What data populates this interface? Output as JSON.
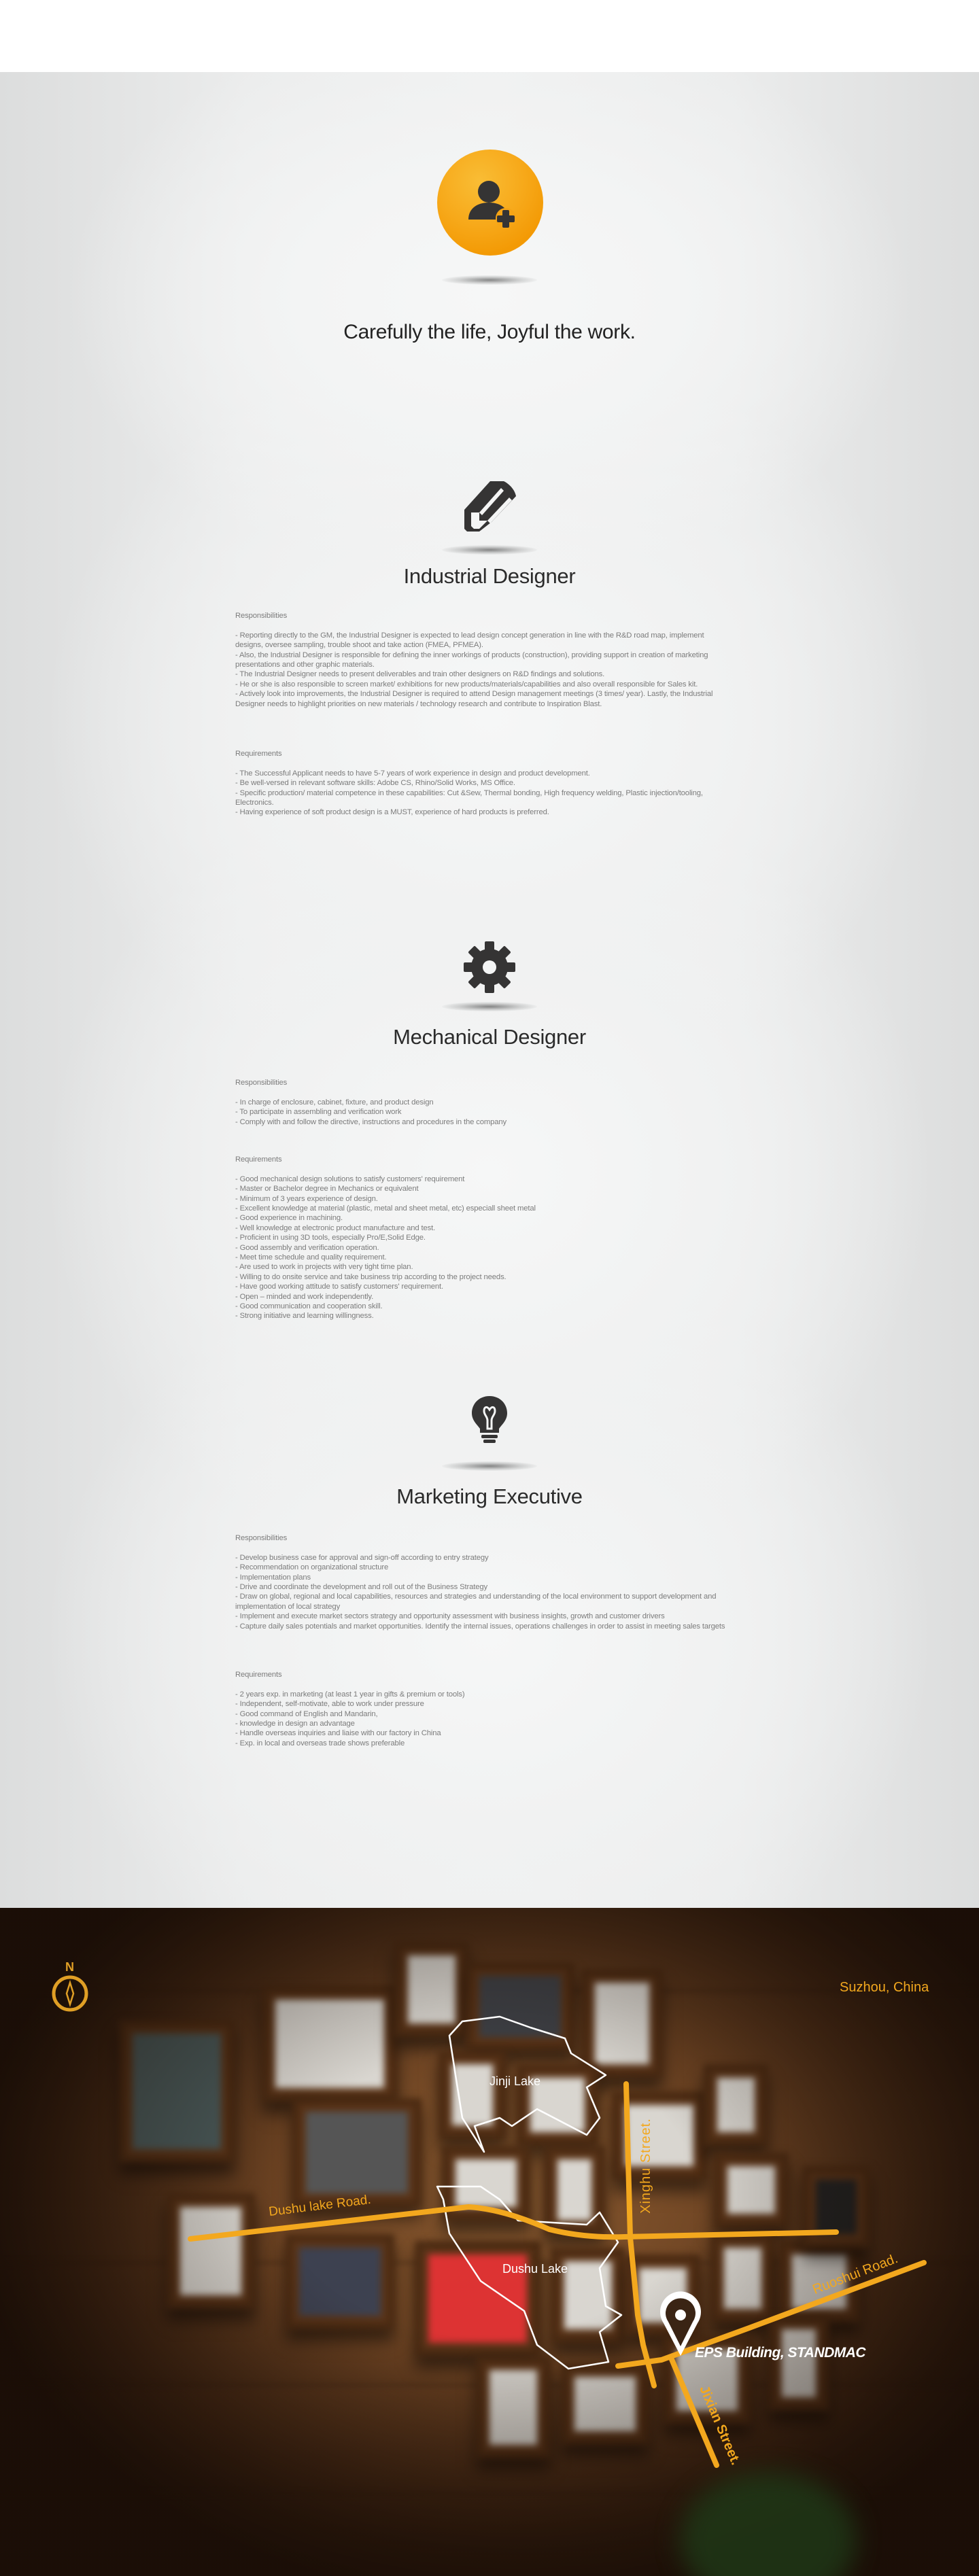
{
  "brand_color": "#f39c12",
  "hero": {
    "icon": "add-user-icon",
    "tagline": "Carefully the life, Joyful the work."
  },
  "positions": [
    {
      "icon": "pencil-icon",
      "title": "Industrial Designer",
      "responsibilities_label": "Responsibilities",
      "responsibilities": [
        "- Reporting directly to the GM, the Industrial Designer is expected to lead design concept generation in line with the R&D road map, implement designs, oversee sampling, trouble shoot and take action (FMEA, PFMEA).",
        "- Also, the Industrial Designer is responsible for defining the inner workings of products (construction), providing support in creation of marketing presentations and other graphic materials.",
        "- The Industrial Designer needs to present deliverables and train other designers on R&D findings and solutions.",
        "- He or she is also responsible to screen market/ exhibitions for new products/materials/capabilities and also overall responsible for Sales kit.",
        "- Actively look into improvements, the Industrial Designer is required to attend Design management meetings (3 times/ year). Lastly, the Industrial Designer needs to highlight priorities on new materials / technology research and contribute to Inspiration Blast."
      ],
      "requirements_label": "Requirements",
      "requirements": [
        "- The Successful Applicant needs to have 5-7 years of work experience in design and product development.",
        "- Be well-versed in relevant software skills: Adobe CS, Rhino/Solid Works, MS Office.",
        "- Specific production/ material competence in these capabilities: Cut &Sew, Thermal bonding, High frequency welding, Plastic injection/tooling, Electronics.",
        "- Having experience of soft product design is a MUST, experience of hard products is preferred."
      ]
    },
    {
      "icon": "gear-icon",
      "title": "Mechanical Designer",
      "responsibilities_label": "Responsibilities",
      "responsibilities": [
        "- In charge of enclosure, cabinet, fixture, and product design",
        "- To participate in assembling and verification work",
        "- Comply with and follow the directive, instructions and procedures in the company"
      ],
      "requirements_label": "Requirements",
      "requirements": [
        "- Good mechanical design solutions to satisfy customers' requirement",
        "- Master or Bachelor degree in Mechanics or equivalent",
        "- Minimum of 3 years experience of design.",
        "- Excellent knowledge at material (plastic, metal and sheet metal, etc) especiall sheet metal",
        "- Good experience in machining.",
        "- Well knowledge at electronic product manufacture and test.",
        "- Proficient in using 3D tools, especially Pro/E,Solid Edge.",
        "- Good assembly and verification operation.",
        "- Meet time schedule and quality requirement.",
        "- Are used to work in projects with very tight time plan.",
        "- Willing to do onsite service and take business trip according to the project needs.",
        "- Have good working attitude to satisfy customers' requirement.",
        "- Open – minded and work independently.",
        "- Good communication and cooperation skill.",
        "- Strong initiative and learning willingness."
      ]
    },
    {
      "icon": "lightbulb-icon",
      "title": "Marketing Executive",
      "responsibilities_label": "Responsibilities",
      "responsibilities": [
        "- Develop business case for approval and sign-off according to entry strategy",
        "- Recommendation on organizational structure",
        "- Implementation plans",
        "- Drive and coordinate the development and roll out of the Business Strategy",
        "- Draw on global, regional and local capabilities, resources and strategies and understanding of the local environment to support development and implementation of local strategy",
        "- Implement and execute market sectors strategy and opportunity assessment with business insights, growth and customer drivers",
        "- Capture daily sales potentials and market opportunities. Identify the internal issues, operations challenges in order to assist in meeting sales targets"
      ],
      "requirements_label": "Requirements",
      "requirements": [
        "- 2 years exp. in marketing (at least 1 year in gifts & premium or tools)",
        "- Independent, self-motivate, able to work under pressure",
        "- Good command of English and Mandarin,",
        "- knowledge in design an advantage",
        "- Handle overseas inquiries and liaise with our factory in China",
        "- Exp. in local and overseas trade shows preferable"
      ]
    }
  ],
  "map": {
    "compass_label": "N",
    "city": "Suzhou, China",
    "road_color": "#f3a81e",
    "roads": {
      "dushu_lake_road": "Dushu lake Road.",
      "xinghu_street": "Xinghu Street.",
      "ruoshui_road": "Ruoshui Road.",
      "jixian_street": "Jixian Street."
    },
    "lakes": {
      "jinji": "Jinji Lake",
      "dushu": "Dushu Lake"
    },
    "location_label": "EPS Building, STANDMAC",
    "location_icon": "map-pin-icon"
  }
}
